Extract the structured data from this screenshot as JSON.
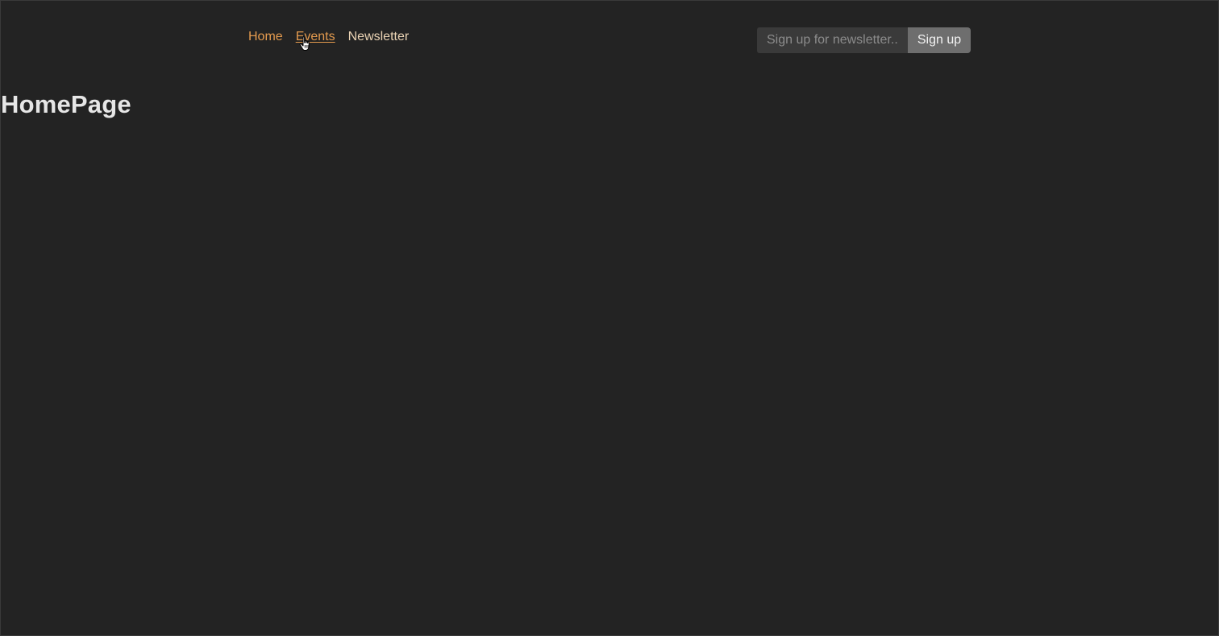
{
  "nav": {
    "items": [
      {
        "label": "Home"
      },
      {
        "label": "Events"
      },
      {
        "label": "Newsletter"
      }
    ]
  },
  "newsletter": {
    "placeholder": "Sign up for newsletter..",
    "value": "",
    "button_label": "Sign up"
  },
  "main": {
    "title": "HomePage"
  },
  "colors": {
    "background": "#232323",
    "accent": "#e39a4e",
    "nav_light": "#ead3b4",
    "button_bg": "#6e6e6e",
    "input_bg": "#3a3a3a"
  }
}
